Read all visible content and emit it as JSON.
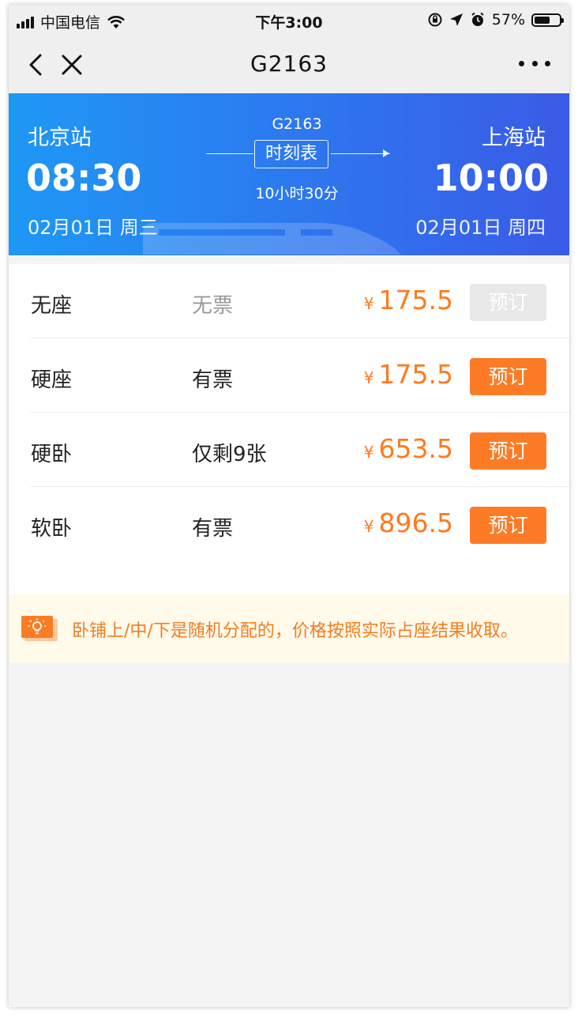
{
  "status_bar": {
    "carrier": "中国电信",
    "time": "下午3:00",
    "battery": "57%",
    "battery_level": 0.57,
    "icons": [
      "signal-icon",
      "wifi-icon",
      "orientation-lock-icon",
      "location-arrow-icon",
      "alarm-icon",
      "battery-icon"
    ]
  },
  "nav": {
    "title": "G2163",
    "icons": [
      "back-chevron-icon",
      "close-icon",
      "more-dots-icon"
    ]
  },
  "train": {
    "number": "G2163",
    "from": {
      "station": "北京站",
      "time": "08:30",
      "date": "02月01日 周三"
    },
    "to": {
      "station": "上海站",
      "time": "10:00",
      "date": "02月01日 周四"
    },
    "timetable_label": "时刻表",
    "duration": "10小时30分"
  },
  "colors": {
    "header_gradient_start": "#1e98f5",
    "header_gradient_end": "#3a5be6",
    "accent_orange": "#fd7b25",
    "price_orange": "#ff7a1f",
    "notice_bg": "#fffaea"
  },
  "seats": [
    {
      "type": "无座",
      "availability": "无票",
      "currency": "¥",
      "price": "175.5",
      "button": "预订",
      "disabled": true
    },
    {
      "type": "硬座",
      "availability": "有票",
      "currency": "¥",
      "price": "175.5",
      "button": "预订",
      "disabled": false
    },
    {
      "type": "硬卧",
      "availability": "仅剩9张",
      "currency": "¥",
      "price": "653.5",
      "button": "预订",
      "disabled": false
    },
    {
      "type": "软卧",
      "availability": "有票",
      "currency": "¥",
      "price": "896.5",
      "button": "预订",
      "disabled": false
    }
  ],
  "notice": {
    "icon": "lightbulb-icon",
    "text": "卧铺上/中/下是随机分配的，价格按照实际占座结果收取。"
  }
}
